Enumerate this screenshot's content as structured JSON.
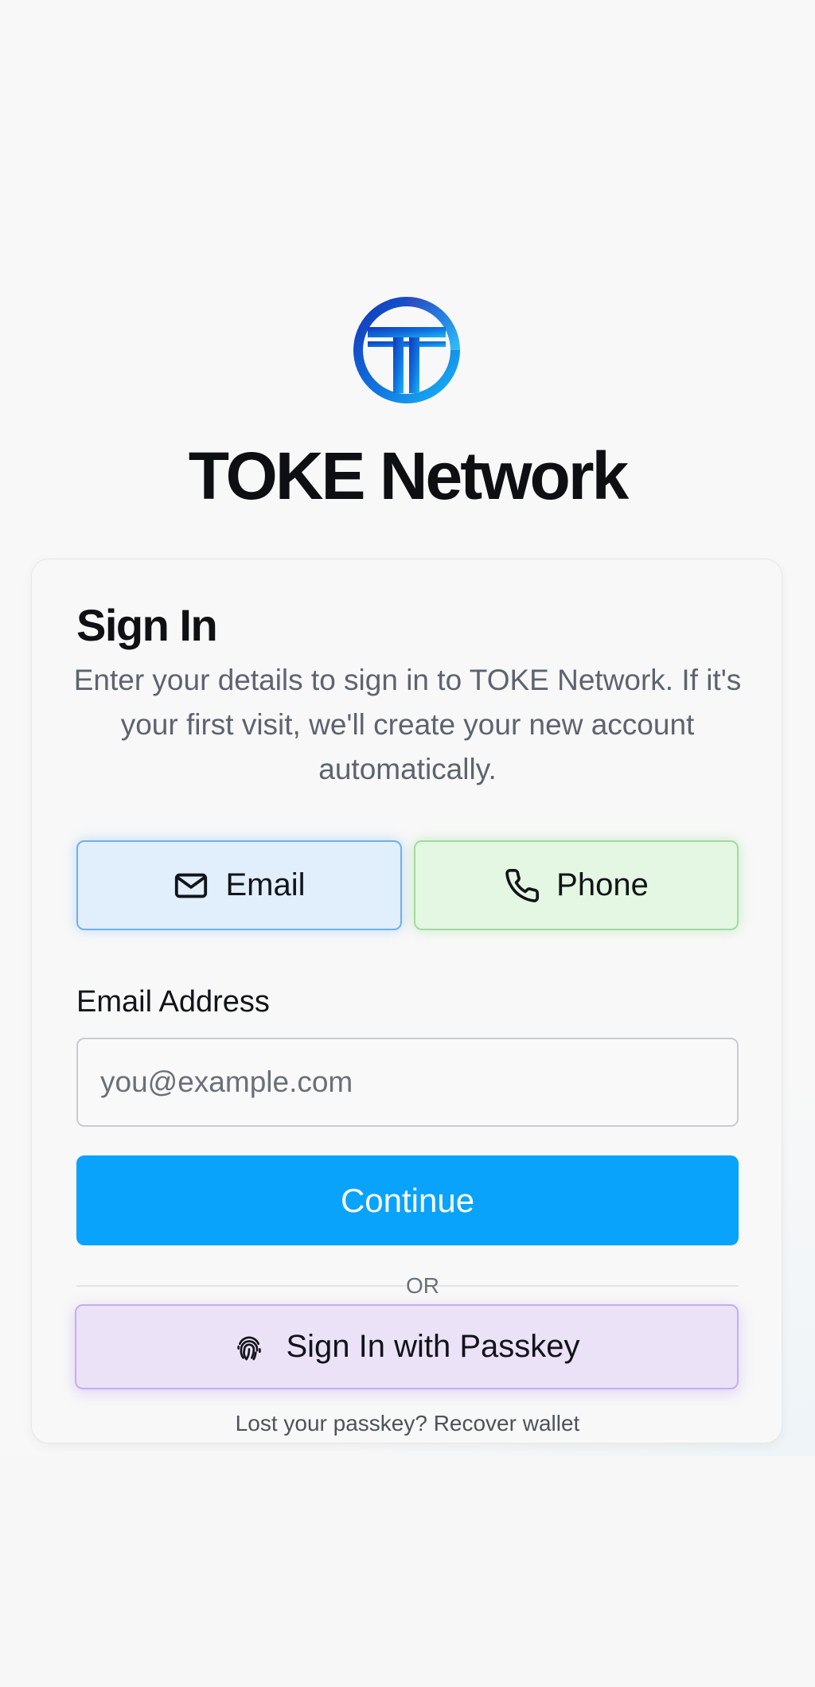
{
  "brand": {
    "name": "TOKE Network",
    "logo_icon": "toke-logo-icon"
  },
  "card": {
    "title": "Sign In",
    "description": "Enter your details to sign in to TOKE Network. If it's your first visit, we'll create your new account automatically."
  },
  "methods": {
    "email": {
      "label": "Email",
      "icon": "envelope-icon"
    },
    "phone": {
      "label": "Phone",
      "icon": "phone-icon"
    }
  },
  "form": {
    "email_label": "Email Address",
    "email_placeholder": "you@example.com",
    "email_value": "",
    "continue_label": "Continue"
  },
  "divider": {
    "text": "OR"
  },
  "passkey": {
    "label": "Sign In with Passkey",
    "icon": "fingerprint-icon"
  },
  "recover": {
    "text": "Lost your passkey? Recover wallet"
  },
  "colors": {
    "primary": "#09a3fb",
    "email_tint": "#e1eefc",
    "phone_tint": "#e3f7e2",
    "passkey_tint": "#ebe2f8",
    "logo_gradient_start": "#1436b8",
    "logo_gradient_end": "#1ab6f5"
  }
}
